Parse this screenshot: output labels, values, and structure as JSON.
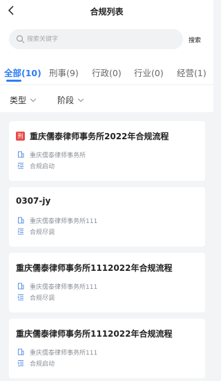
{
  "header": {
    "title": "合规列表"
  },
  "search": {
    "placeholder": "搜索关键字",
    "value": "",
    "button_label": "搜索"
  },
  "tabs": [
    {
      "label": "全部(10)",
      "active": true
    },
    {
      "label": "刑事(9)",
      "active": false
    },
    {
      "label": "行政(0)",
      "active": false
    },
    {
      "label": "行业(0)",
      "active": false
    },
    {
      "label": "经营(1)",
      "active": false
    }
  ],
  "filters": {
    "type_label": "类型",
    "stage_label": "阶段"
  },
  "colors": {
    "accent": "#2f7df6",
    "badge": "#e84a4a"
  },
  "cards": [
    {
      "badge": "刑",
      "title": "重庆儒泰律师事务所2022年合规流程",
      "firm": "重庆儒泰律师事务所",
      "stage": "合规启动"
    },
    {
      "title": "0307-jy",
      "firm": "重庆儒泰律师事务所111",
      "stage": "合规尽调"
    },
    {
      "title": "重庆儒泰律师事务所1112022年合规流程",
      "firm": "重庆儒泰律师事务所111",
      "stage": "合规尽调"
    },
    {
      "title": "重庆儒泰律师事务所1112022年合规流程",
      "firm": "重庆儒泰律师事务所111",
      "stage": "合规启动"
    }
  ]
}
